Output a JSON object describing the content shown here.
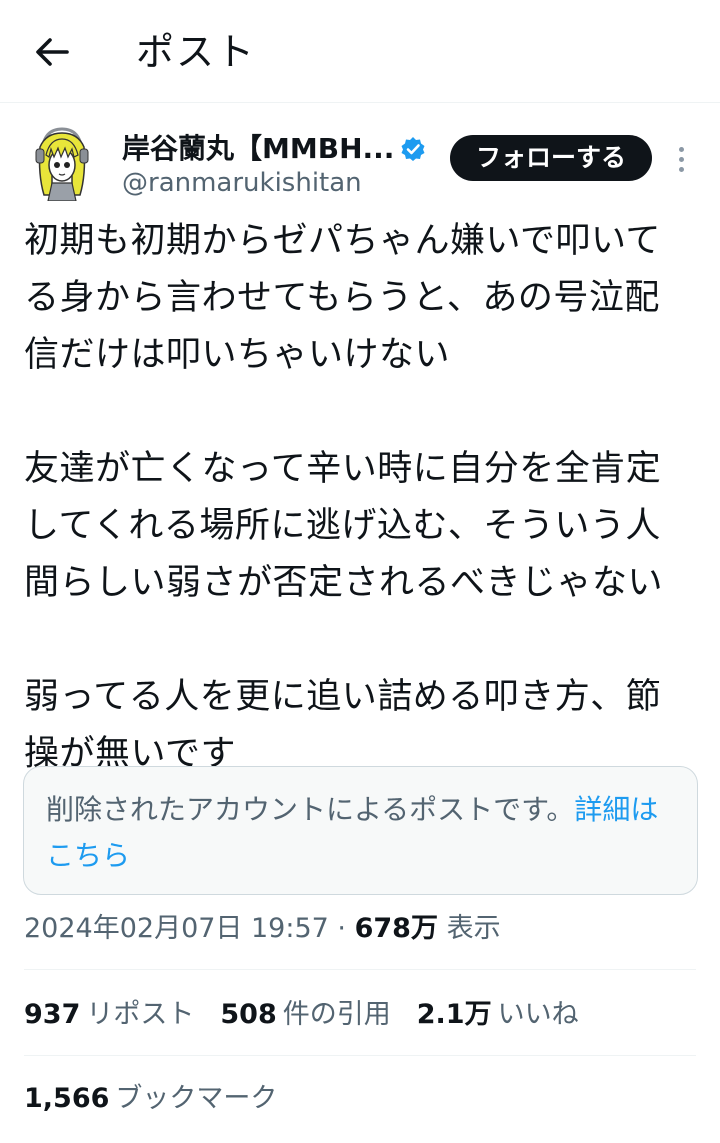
{
  "header": {
    "title": "ポスト",
    "back_icon": "arrow-left-icon"
  },
  "author": {
    "display_name": "岸谷蘭丸【MMBH...",
    "handle": "@ranmarukishitan",
    "verified_color": "#1d9bf0",
    "avatar_icon": "avatar-illustration"
  },
  "actions": {
    "follow_label": "フォローする",
    "more_icon": "more-vertical-icon"
  },
  "post": {
    "paragraphs": [
      {
        "lines": [
          "初期も初期からゼパちゃん嫌いで叩いて",
          "る身から言わせてもらうと、あの号泣配",
          "信だけは叩いちゃいけない"
        ]
      },
      {
        "lines": [
          "友達が亡くなって辛い時に自分を全肯定",
          "してくれる場所に逃げ込む、そういう人",
          "間らしい弱さが否定されるべきじゃない"
        ]
      },
      {
        "lines": [
          "弱ってる人を更に追い詰める叩き方、節",
          "操が無いです"
        ]
      }
    ]
  },
  "notice": {
    "text": "削除されたアカウントによるポストです。",
    "link_text": "詳細はこちら"
  },
  "meta": {
    "datetime": "2024年02月07日 19:57",
    "separator": "·",
    "views": "678万",
    "views_label": "表示"
  },
  "stats": [
    {
      "count": "937",
      "label": "リポスト"
    },
    {
      "count": "508",
      "label": "件の引用"
    },
    {
      "count": "2.1万",
      "label": "いいね"
    }
  ],
  "bookmarks": {
    "count": "1,566",
    "label": "ブックマーク"
  },
  "colors": {
    "accent": "#1d9bf0",
    "text": "#0f1419",
    "muted": "#536471"
  }
}
